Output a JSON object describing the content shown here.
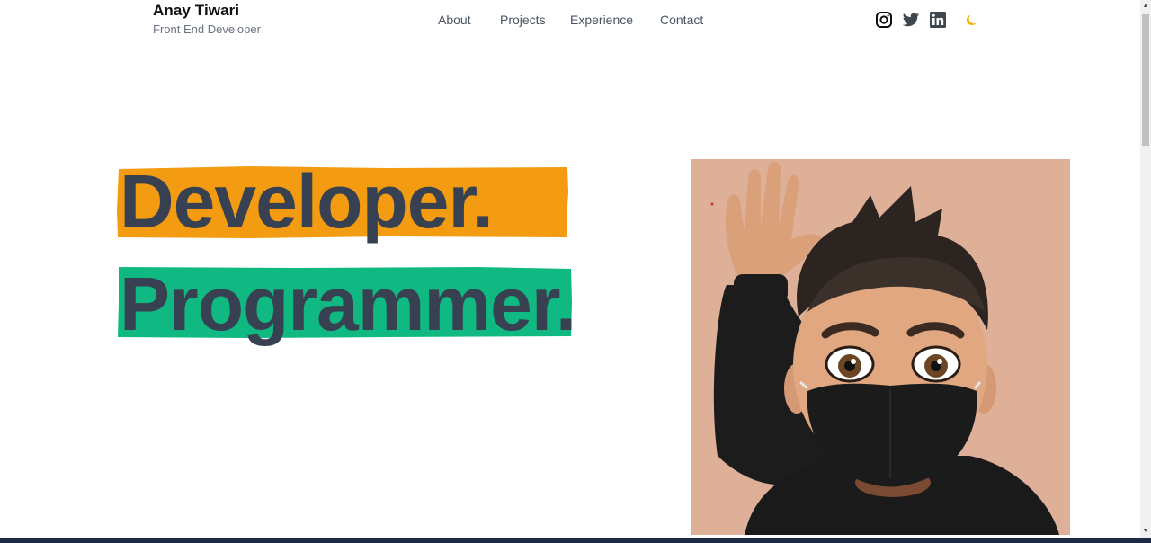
{
  "header": {
    "name": "Anay Tiwari",
    "subtitle": "Front End Developer"
  },
  "nav": {
    "items": [
      {
        "label": "About"
      },
      {
        "label": "Projects"
      },
      {
        "label": "Experience"
      },
      {
        "label": "Contact"
      }
    ]
  },
  "social": {
    "icons": [
      "instagram-icon",
      "twitter-icon",
      "linkedin-icon",
      "moon-icon"
    ],
    "theme_accent": "#f4b400"
  },
  "hero": {
    "line1": "Developer.",
    "line2": "Programmer.",
    "line1_highlight": "#f39c12",
    "line2_highlight": "#10b981",
    "text_color": "#374151"
  },
  "avatar": {
    "background": "#deb097"
  }
}
